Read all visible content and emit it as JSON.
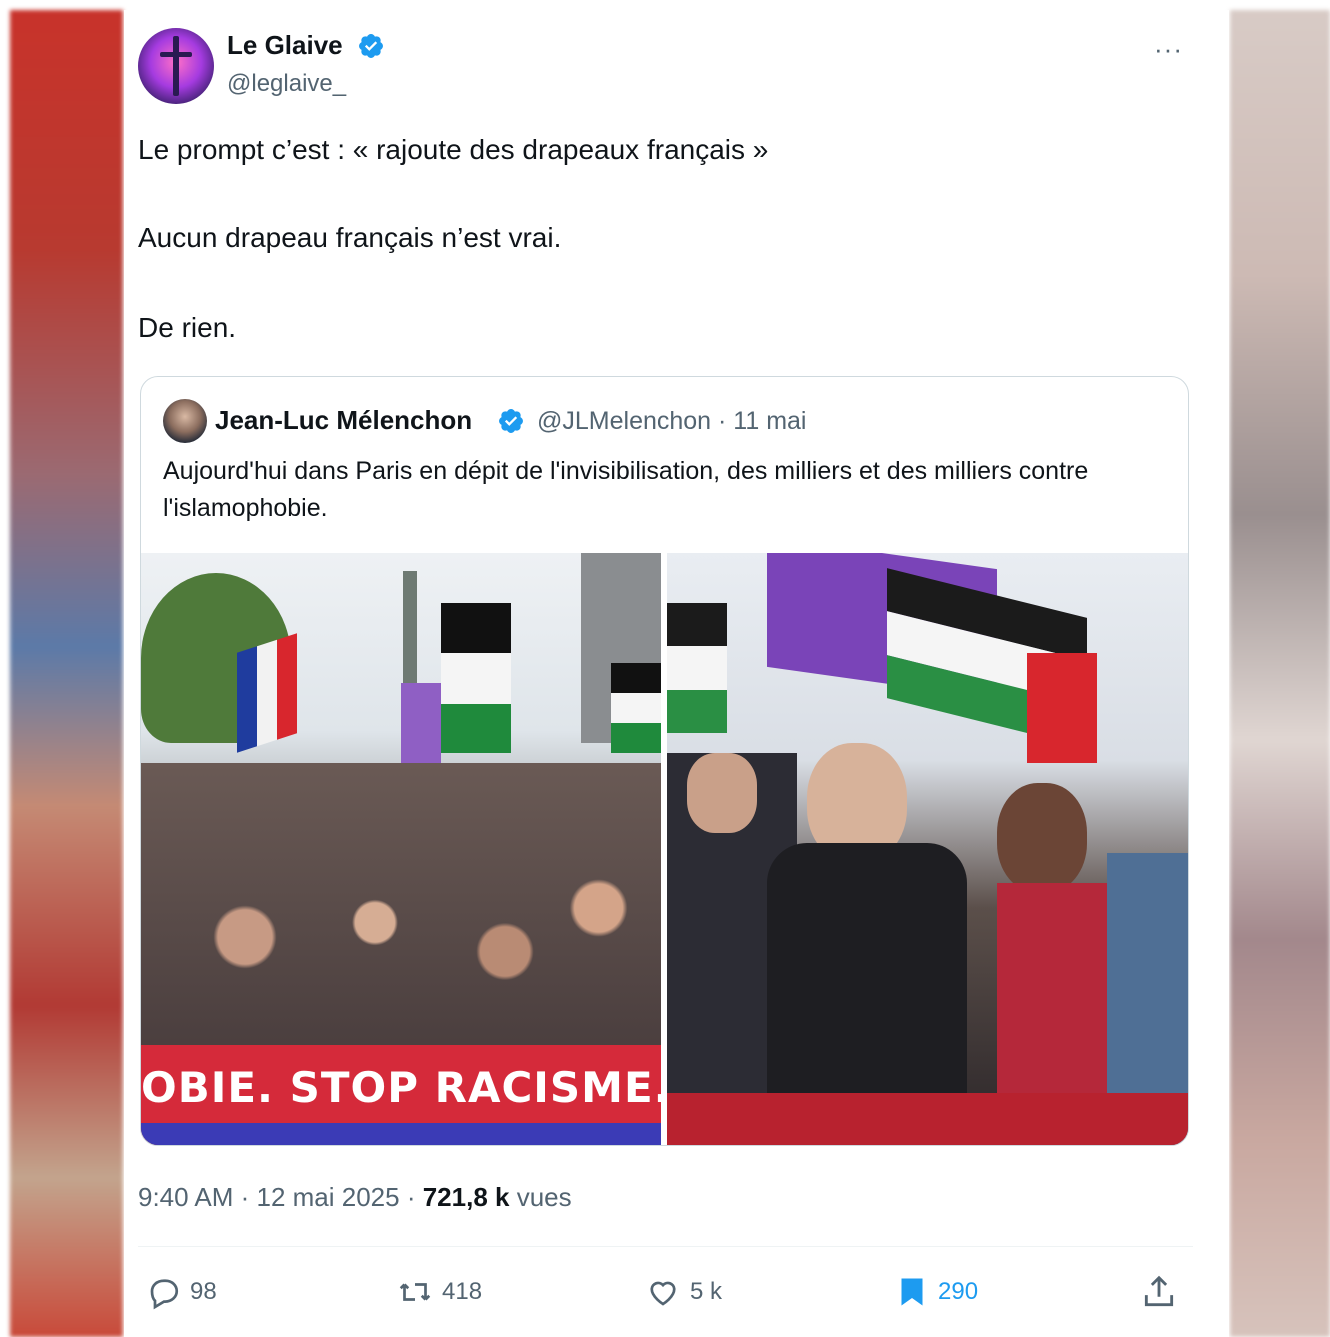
{
  "tweet": {
    "author_name": "Le Glaive",
    "author_handle": "@leglaive_",
    "more_label": "···",
    "text_lines": [
      "Le prompt c’est : « rajoute des drapeaux français »",
      "Aucun drapeau français n’est vrai.",
      "De rien."
    ],
    "timestamp": "9:40 AM · 12 mai 2025 · ",
    "views_count": "721,8 k",
    "views_label": " vues"
  },
  "quoted": {
    "author_name": "Jean-Luc Mélenchon",
    "meta": "@JLMelenchon · 11 mai",
    "text": "Aujourd'hui dans Paris en dépit de l'invisibilisation, des milliers et des milliers contre l'islamophobie.",
    "banner_text": "OBIE. STOP RACISME."
  },
  "actions": {
    "replies": "98",
    "reposts": "418",
    "likes": "5 k",
    "bookmarks": "290"
  },
  "colors": {
    "accent": "#1d9bf0",
    "text": "#0f1419",
    "muted": "#536471"
  },
  "icons": [
    "verified-badge-icon",
    "more-icon",
    "reply-icon",
    "repost-icon",
    "like-icon",
    "bookmark-icon",
    "share-icon"
  ]
}
